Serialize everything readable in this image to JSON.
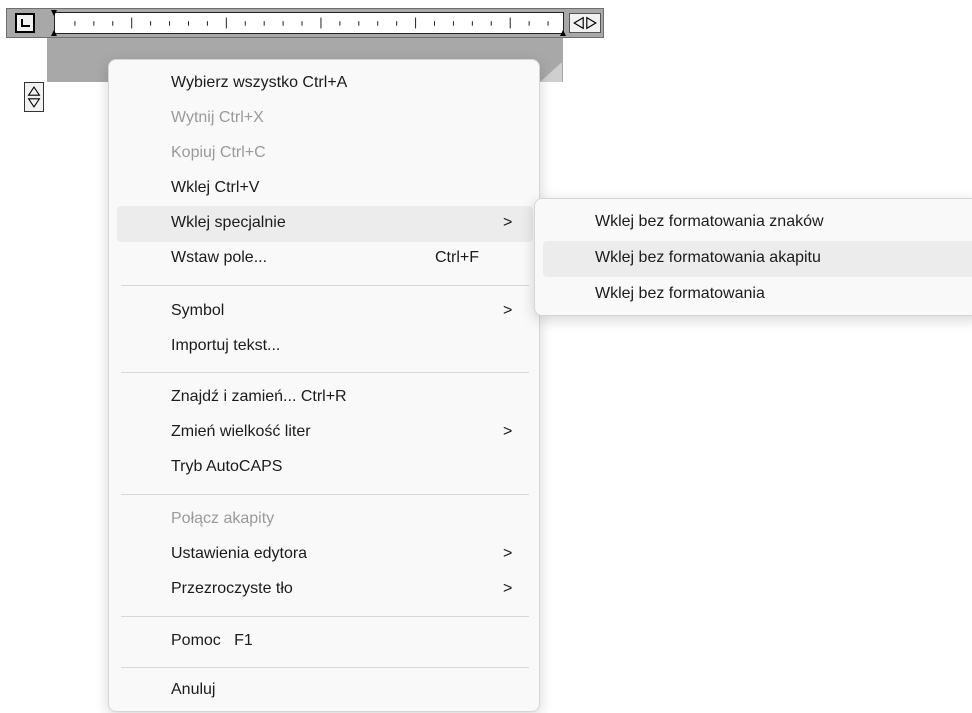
{
  "menu": {
    "items": [
      {
        "label": "Wybierz wszystko Ctrl+A"
      },
      {
        "label": "Wytnij Ctrl+X"
      },
      {
        "label": "Kopiuj Ctrl+C"
      },
      {
        "label": "Wklej Ctrl+V"
      },
      {
        "label": "Wklej specjalnie",
        "arrow": ">"
      },
      {
        "label": "Wstaw pole...",
        "shortcut": "Ctrl+F"
      },
      {
        "label": "Symbol",
        "arrow": ">"
      },
      {
        "label": "Importuj tekst..."
      },
      {
        "label": "Znajdź i zamień... Ctrl+R"
      },
      {
        "label": "Zmień wielkość liter",
        "arrow": ">"
      },
      {
        "label": "Tryb AutoCAPS"
      },
      {
        "label": "Połącz akapity"
      },
      {
        "label": "Ustawienia edytora",
        "arrow": ">"
      },
      {
        "label": "Przezroczyste tło",
        "arrow": ">"
      },
      {
        "label": "Pomoc   F1"
      },
      {
        "label": "Anuluj"
      }
    ]
  },
  "submenu": {
    "items": [
      {
        "label": "Wklej bez formatowania znaków"
      },
      {
        "label": "Wklej bez formatowania akapitu"
      },
      {
        "label": "Wklej bez formatowania"
      }
    ]
  },
  "icons": {
    "tab_type": "tab-type-icon",
    "width_arrows": "left-right-arrows-icon",
    "height_arrows": "up-down-arrows-icon"
  },
  "colors": {
    "ruler_gray": "#a8a8a8",
    "menu_bg": "#f9f9f9",
    "highlight": "#ececec",
    "disabled_text": "#9a9a9a"
  }
}
